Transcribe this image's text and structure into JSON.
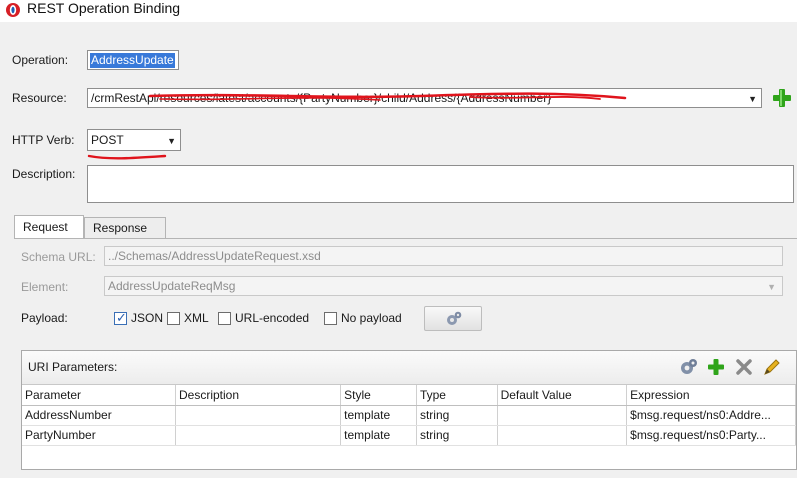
{
  "window": {
    "title": "REST Operation Binding"
  },
  "labels": {
    "operation": "Operation:",
    "resource": "Resource:",
    "http_verb": "HTTP Verb:",
    "description": "Description:"
  },
  "operation": {
    "value": "AddressUpdate"
  },
  "resource": {
    "value": "/crmRestApi/resources/latest/accounts/{PartyNumber}/child/Address/{AddressNumber}"
  },
  "http_verb": {
    "value": "POST"
  },
  "description": {
    "value": ""
  },
  "tabs": [
    {
      "label": "Request",
      "active": true
    },
    {
      "label": "Response",
      "active": false
    }
  ],
  "request": {
    "schema_url_label": "Schema URL:",
    "schema_url_value": "../Schemas/AddressUpdateRequest.xsd",
    "element_label": "Element:",
    "element_value": "AddressUpdateReqMsg",
    "payload_label": "Payload:",
    "payload_options": [
      {
        "label": "JSON",
        "checked": true
      },
      {
        "label": "XML",
        "checked": false
      },
      {
        "label": "URL-encoded",
        "checked": false
      },
      {
        "label": "No payload",
        "checked": false
      }
    ]
  },
  "uri_parameters": {
    "title": "URI Parameters:",
    "columns": [
      "Parameter",
      "Description",
      "Style",
      "Type",
      "Default Value",
      "Expression"
    ],
    "rows": [
      [
        "AddressNumber",
        "",
        "template",
        "string",
        "",
        "$msg.request/ns0:Addre..."
      ],
      [
        "PartyNumber",
        "",
        "template",
        "string",
        "",
        "$msg.request/ns0:Party..."
      ]
    ]
  },
  "icons": {
    "app": "oracle-app-icon",
    "add": "green-plus-icon",
    "gear": "gear-icon",
    "delete": "gray-x-icon",
    "edit": "pencil-icon"
  },
  "colors": {
    "accent_selection": "#3879d9",
    "add_green": "#2fa41a",
    "annotation_red": "#e0141c"
  }
}
